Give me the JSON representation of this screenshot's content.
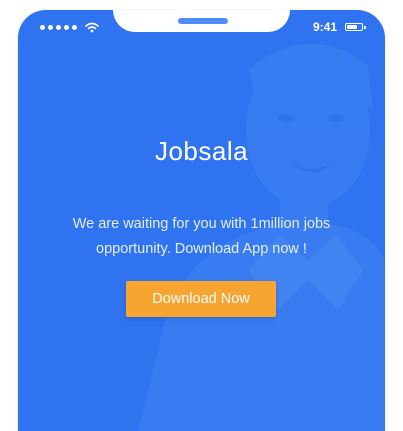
{
  "status_bar": {
    "time": "9:41",
    "signal_dots": 5,
    "battery_level": 0.8,
    "icons": [
      "signal-dots-icon",
      "wifi-icon",
      "battery-icon"
    ]
  },
  "hero": {
    "title": "Jobsala",
    "subtitle": "We are waiting for you with 1million jobs opportunity. Download App now !",
    "cta_label": "Download Now"
  },
  "colors": {
    "background": "#2f73f0",
    "accent": "#f6a531",
    "text": "#ffffff"
  }
}
